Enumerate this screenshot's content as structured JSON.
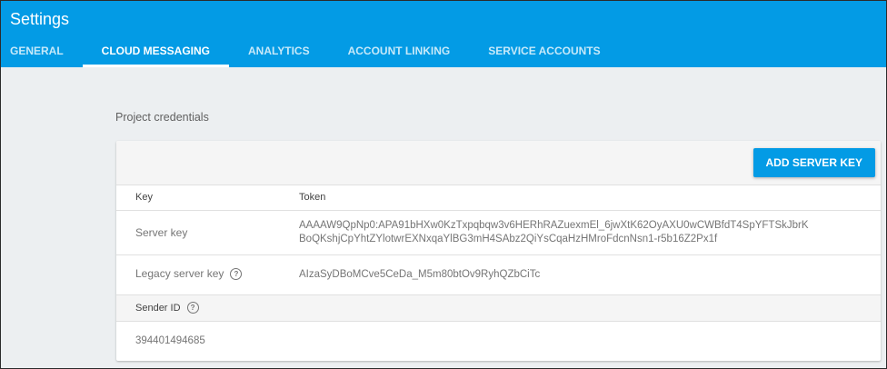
{
  "header": {
    "title": "Settings",
    "tabs": [
      {
        "label": "GENERAL"
      },
      {
        "label": "CLOUD MESSAGING",
        "active": true
      },
      {
        "label": "ANALYTICS"
      },
      {
        "label": "ACCOUNT LINKING"
      },
      {
        "label": "SERVICE ACCOUNTS"
      }
    ]
  },
  "credentials": {
    "section_label": "Project credentials",
    "add_button": "ADD SERVER KEY",
    "columns": {
      "key": "Key",
      "token": "Token"
    },
    "rows": [
      {
        "label": "Server key",
        "value_line1": "AAAAW9QpNp0:APA91bHXw0KzTxpqbqw3v6HERhRAZuexmEl_6jwXtK62OyAXU0wCWBfdT4SpYFTSkJbrK",
        "value_line2": "BoQKshjCpYhtZYlotwrEXNxqaYlBG3mH4SAbz2QiYsCqaHzHMroFdcnNsn1-r5b16Z2Px1f"
      },
      {
        "label": "Legacy server key",
        "value": "AIzaSyDBoMCve5CeDa_M5m80btOv9RyhQZbCiTc"
      }
    ],
    "sender": {
      "label": "Sender ID",
      "value": "394401494685"
    }
  },
  "icons": {
    "help": "help-circle-icon"
  },
  "colors": {
    "primary": "#039be5",
    "background": "#eceff1"
  }
}
